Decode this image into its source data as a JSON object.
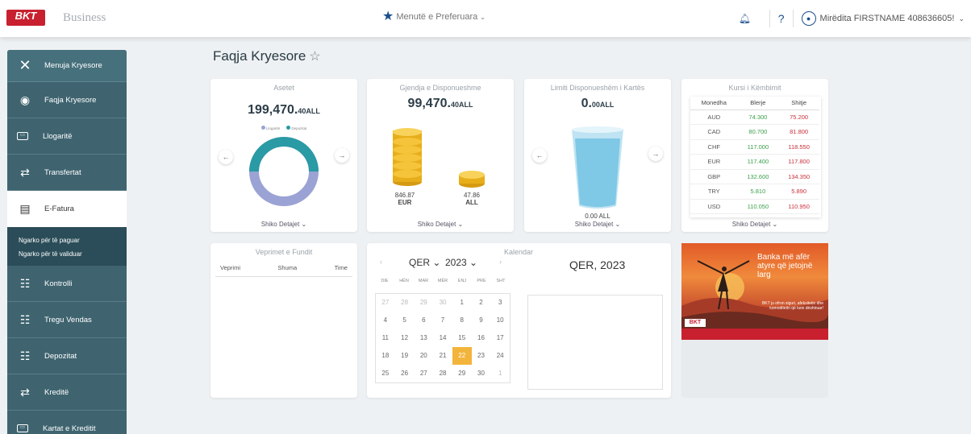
{
  "header": {
    "logo_text": "BKT",
    "brand_sub": "Business",
    "favorites_label": "Menutë e Preferuara",
    "help_label": "?",
    "user_label": "Mirëdita FIRSTNAME 408636605!"
  },
  "sidebar": {
    "close_label": "Menuja Kryesore",
    "items": [
      {
        "label": "Faqja Kryesore",
        "icon": "compass-icon"
      },
      {
        "label": "Llogaritë",
        "icon": "card-icon"
      },
      {
        "label": "Transfertat",
        "icon": "transfer-icon"
      },
      {
        "label": "E-Fatura",
        "icon": "invoice-icon"
      },
      {
        "label": "Kontrolli",
        "icon": "checklist-icon"
      },
      {
        "label": "Tregu Vendas",
        "icon": "checklist-icon"
      },
      {
        "label": "Depozitat",
        "icon": "checklist-icon"
      },
      {
        "label": "Kreditë",
        "icon": "transfer-icon"
      },
      {
        "label": "Kartat e Kreditit",
        "icon": "card-icon"
      }
    ],
    "submenu": [
      "Ngarko për të paguar",
      "Ngarko për të validuar"
    ]
  },
  "page": {
    "title": "Faqja Kryesore"
  },
  "assets": {
    "title": "Asetet",
    "amount_int": "199,470.",
    "amount_dec": "40",
    "currency": "ALL",
    "legend": [
      "Llogaritë",
      "Depozitat"
    ],
    "legend_colors": [
      "#9aa3d4",
      "#2a9aa4"
    ],
    "details": "Shiko Detajet"
  },
  "available": {
    "title": "Gjendja e Disponueshme",
    "amount_int": "99,470.",
    "amount_dec": "40",
    "currency": "ALL",
    "eur_value": "846.87",
    "eur_label": "EUR",
    "all_value": "47.86",
    "all_label": "ALL",
    "details": "Shiko Detajet"
  },
  "card_limit": {
    "title": "Limiti Disponueshëm i Kartës",
    "amount_int": "0.",
    "amount_dec": "00",
    "currency": "ALL",
    "bottom_value": "0.00 ALL",
    "details": "Shiko Detajet"
  },
  "rates": {
    "title": "Kursi i Këmbimit",
    "columns": [
      "Monedha",
      "Blerje",
      "Shitje"
    ],
    "rows": [
      [
        "AUD",
        "74.300",
        "75.200"
      ],
      [
        "CAD",
        "80.700",
        "81.800"
      ],
      [
        "CHF",
        "117.000",
        "118.550"
      ],
      [
        "EUR",
        "117.400",
        "117.800"
      ],
      [
        "GBP",
        "132.600",
        "134.350"
      ],
      [
        "TRY",
        "5.810",
        "5.890"
      ],
      [
        "USD",
        "110.050",
        "110.950"
      ]
    ],
    "details": "Shiko Detajet"
  },
  "transactions": {
    "title": "Veprimet e Fundit",
    "columns": [
      "Veprimi",
      "Shuma",
      "Time"
    ]
  },
  "calendar": {
    "title": "Kalendar",
    "month": "QER",
    "year": "2023",
    "heading": "QER, 2023",
    "weekdays": [
      "DIE",
      "HËN",
      "MAR",
      "MËR",
      "ENJ",
      "PRE",
      "SHT"
    ],
    "weeks": [
      [
        "27",
        "28",
        "29",
        "30",
        "1",
        "2",
        "3"
      ],
      [
        "4",
        "5",
        "6",
        "7",
        "8",
        "9",
        "10"
      ],
      [
        "11",
        "12",
        "13",
        "14",
        "15",
        "16",
        "17"
      ],
      [
        "18",
        "19",
        "20",
        "21",
        "22",
        "23",
        "24"
      ],
      [
        "25",
        "26",
        "27",
        "28",
        "29",
        "30",
        "1"
      ]
    ],
    "today": "22"
  },
  "banner": {
    "headline": "Banka më afër atyre që jetojnë larg",
    "sub": "BKT ju ofron siguri, afeksitetin dhe komoditetin që keni dëshiruar!",
    "logo": "BKT"
  },
  "colors": {
    "sidebar": "#3f6470",
    "accent_today": "#f3b43c",
    "buy": "#3aa04a",
    "sell": "#c8303a",
    "brand": "#c8202f"
  }
}
